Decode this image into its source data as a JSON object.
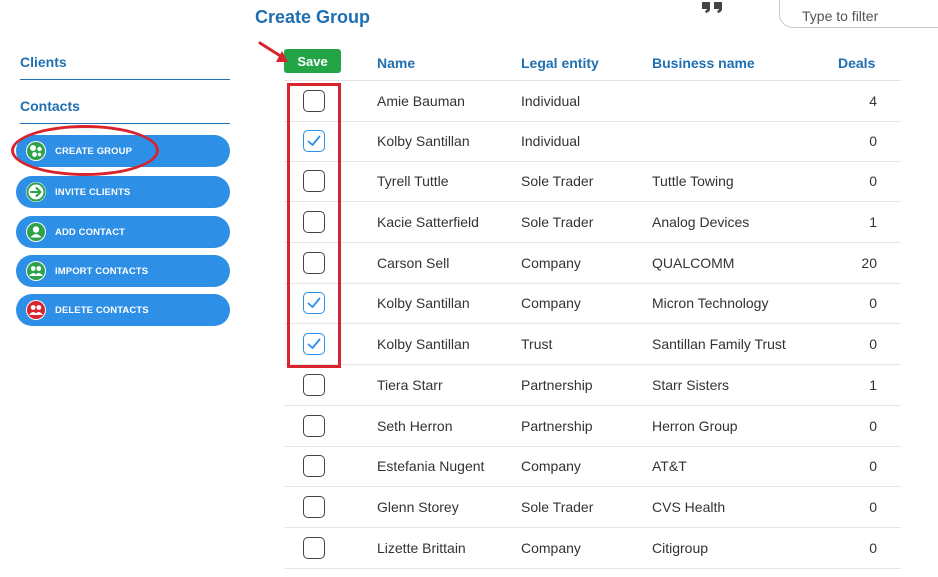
{
  "header": {
    "title": "Create Group",
    "filter_placeholder": "Type to filter",
    "quote_icon": "quote-icon"
  },
  "sidebar": {
    "links": [
      {
        "label": "Clients"
      },
      {
        "label": "Contacts"
      }
    ],
    "buttons": [
      {
        "label": "CREATE GROUP",
        "icon": "group-icon"
      },
      {
        "label": "INVITE CLIENTS",
        "icon": "arrow-right-icon"
      },
      {
        "label": "ADD CONTACT",
        "icon": "person-icon"
      },
      {
        "label": "IMPORT CONTACTS",
        "icon": "people-icon"
      },
      {
        "label": "DELETE CONTACTS",
        "icon": "people-delete-icon"
      }
    ]
  },
  "toolbar": {
    "save_label": "Save"
  },
  "table": {
    "columns": [
      "Name",
      "Legal entity",
      "Business name",
      "Deals"
    ],
    "rows": [
      {
        "checked": false,
        "name": "Amie Bauman",
        "legal": "Individual",
        "business": "",
        "deals": "4"
      },
      {
        "checked": true,
        "name": "Kolby Santillan",
        "legal": "Individual",
        "business": "",
        "deals": "0"
      },
      {
        "checked": false,
        "name": "Tyrell Tuttle",
        "legal": "Sole Trader",
        "business": "Tuttle Towing",
        "deals": "0"
      },
      {
        "checked": false,
        "name": "Kacie Satterfield",
        "legal": "Sole Trader",
        "business": "Analog Devices",
        "deals": "1"
      },
      {
        "checked": false,
        "name": "Carson Sell",
        "legal": "Company",
        "business": "QUALCOMM",
        "deals": "20"
      },
      {
        "checked": true,
        "name": "Kolby Santillan",
        "legal": "Company",
        "business": "Micron Technology",
        "deals": "0"
      },
      {
        "checked": true,
        "name": "Kolby Santillan",
        "legal": "Trust",
        "business": "Santillan Family Trust",
        "deals": "0"
      },
      {
        "checked": false,
        "name": "Tiera Starr",
        "legal": "Partnership",
        "business": "Starr Sisters",
        "deals": "1"
      },
      {
        "checked": false,
        "name": "Seth Herron",
        "legal": "Partnership",
        "business": "Herron Group",
        "deals": "0"
      },
      {
        "checked": false,
        "name": "Estefania Nugent",
        "legal": "Company",
        "business": "AT&T",
        "deals": "0"
      },
      {
        "checked": false,
        "name": "Glenn Storey",
        "legal": "Sole Trader",
        "business": "CVS Health",
        "deals": "0"
      },
      {
        "checked": false,
        "name": "Lizette Brittain",
        "legal": "Company",
        "business": "Citigroup",
        "deals": "0"
      }
    ]
  },
  "colors": {
    "accent": "#1f6fb2",
    "button_blue": "#2d8fe6",
    "save_green": "#22a447",
    "annotation_red": "#d9232d"
  }
}
